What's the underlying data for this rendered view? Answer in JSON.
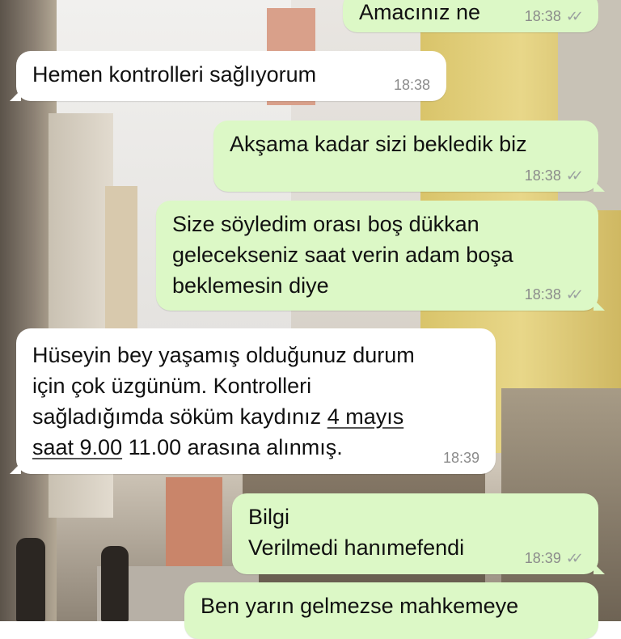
{
  "messages": [
    {
      "direction": "outgoing",
      "text": "Amacınız ne",
      "time": "18:38",
      "status_icon": "double-check-icon"
    },
    {
      "direction": "incoming",
      "text": "Hemen kontrolleri sağlıyorum",
      "time": "18:38"
    },
    {
      "direction": "outgoing",
      "text": "Akşama kadar sizi bekledik biz",
      "time": "18:38",
      "status_icon": "double-check-icon"
    },
    {
      "direction": "outgoing",
      "lines": [
        "Size söyledim orası boş dükkan",
        "gelecekseniz saat verin adam boşa",
        "beklemesin diye"
      ],
      "time": "18:38",
      "status_icon": "double-check-icon"
    },
    {
      "direction": "incoming",
      "lines": [
        "Hüseyin bey yaşamış olduğunuz durum",
        "için çok üzgünüm. Kontrolleri"
      ],
      "line3_prefix": "sağladığımda söküm kaydınız ",
      "line3_link": "4 mayıs",
      "line4_link": "saat 9.00",
      "line4_suffix": " 11.00 arasına alınmış.",
      "time": "18:39"
    },
    {
      "direction": "outgoing",
      "lines": [
        "Bilgi",
        "Verilmedi hanımefendi"
      ],
      "time": "18:39",
      "status_icon": "double-check-icon"
    },
    {
      "direction": "outgoing",
      "text": "Ben yarın gelmezse mahkemeye",
      "time": "",
      "status_icon": ""
    }
  ],
  "colors": {
    "incoming_bubble": "#ffffff",
    "outgoing_bubble": "#dcf8c6",
    "meta_text": "#8b8b8b"
  }
}
